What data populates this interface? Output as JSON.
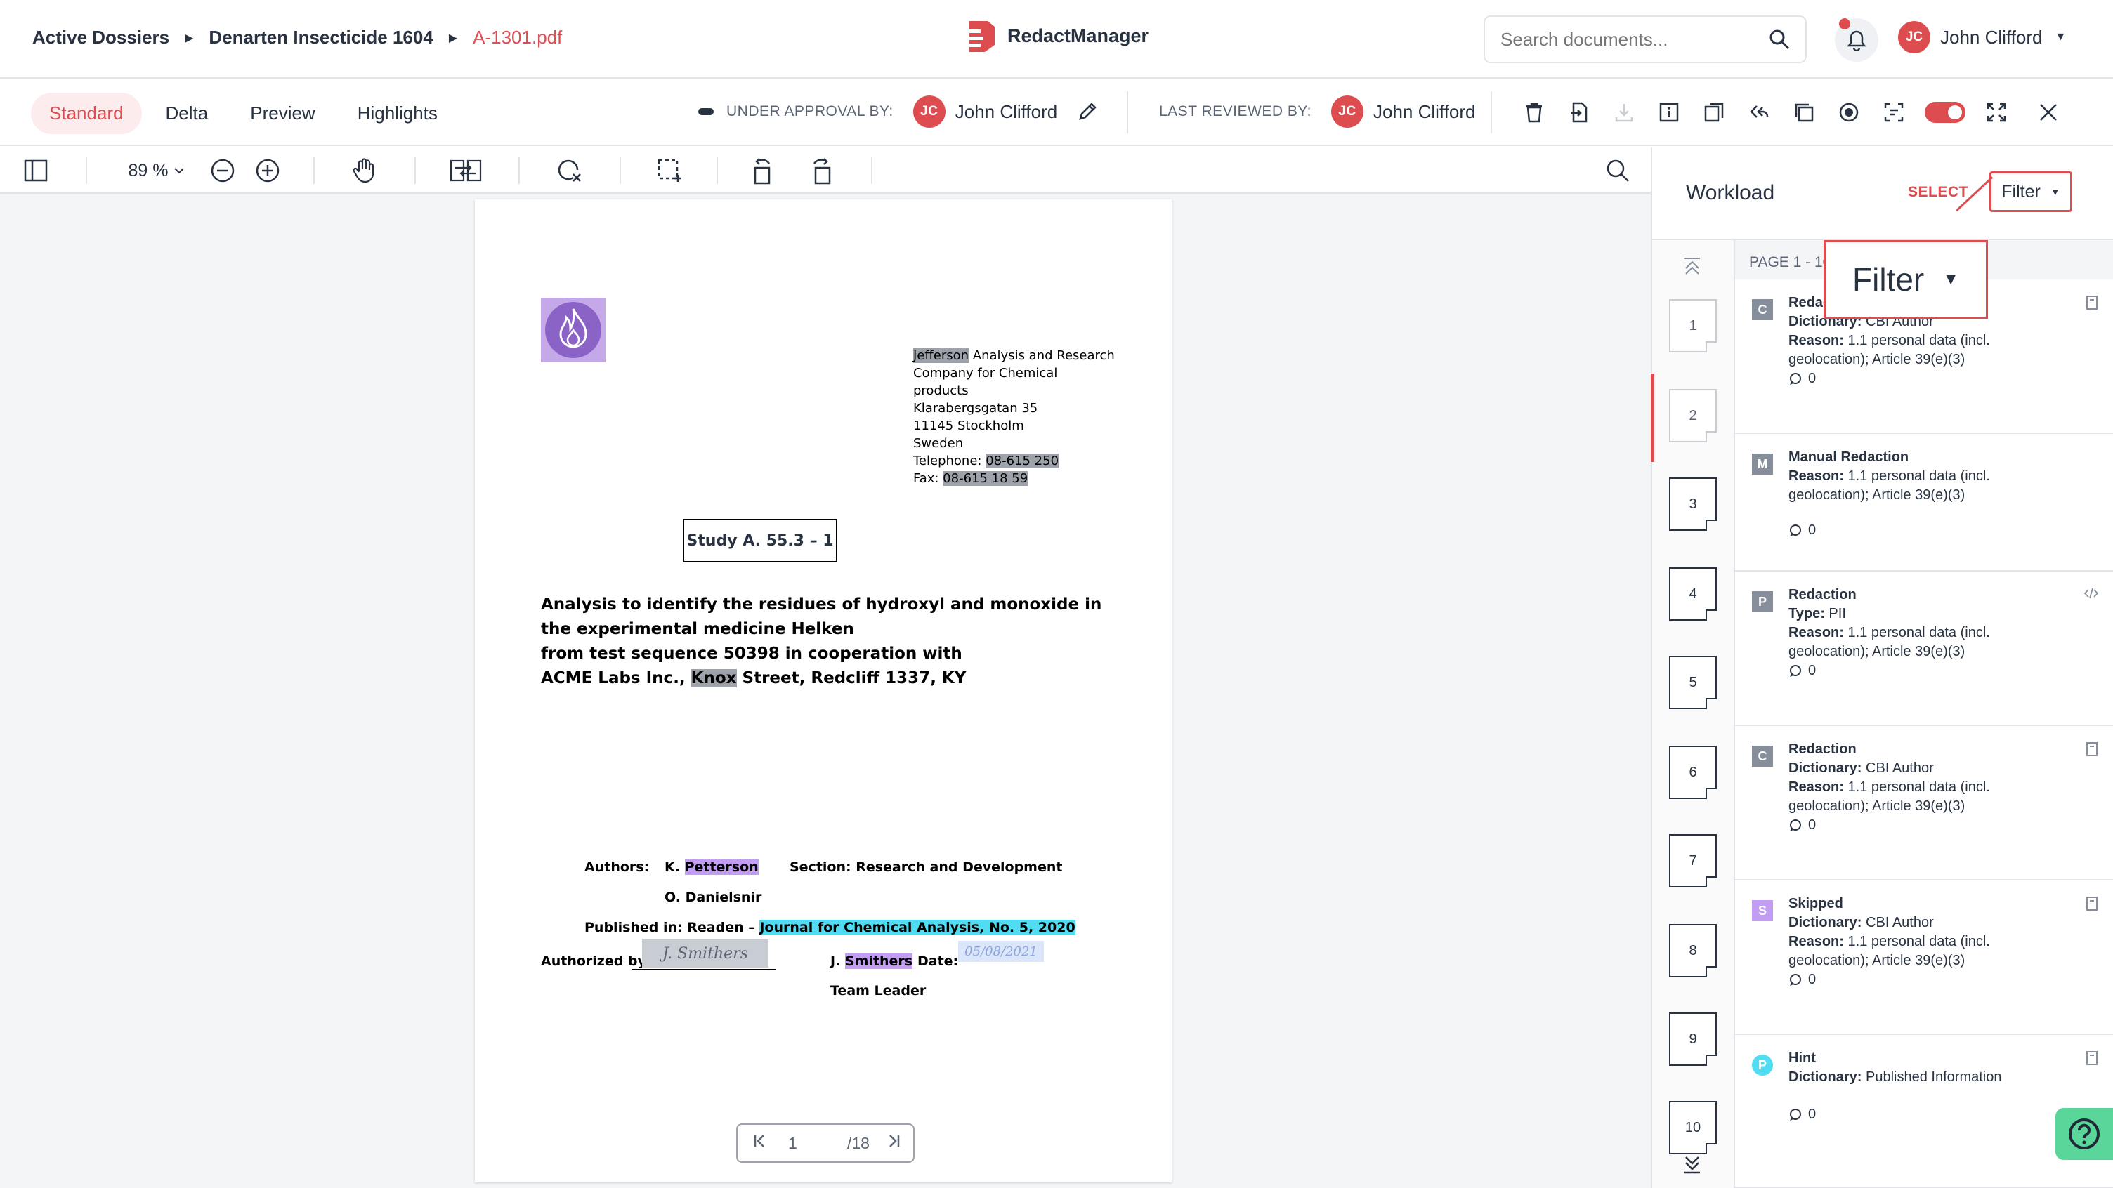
{
  "breadcrumb": {
    "items": [
      "Active Dossiers",
      "Denarten Insecticide 1604"
    ],
    "current": "A-1301.pdf"
  },
  "brand": {
    "name": "RedactManager"
  },
  "search": {
    "placeholder": "Search documents..."
  },
  "user": {
    "initials": "JC",
    "name": "John Clifford"
  },
  "tabs": [
    "Standard",
    "Delta",
    "Preview",
    "Highlights"
  ],
  "approval": {
    "label": "UNDER APPROVAL BY:",
    "initials": "JC",
    "name": "John Clifford"
  },
  "reviewed": {
    "label": "LAST REVIEWED BY:",
    "initials": "JC",
    "name": "John Clifford"
  },
  "viewer": {
    "zoom": "89 %"
  },
  "document": {
    "address": [
      "Jefferson",
      " Analysis and Research",
      "Company for Chemical",
      "products",
      "Klarabergsgatan 35",
      "11145 Stockholm",
      "Sweden",
      "Telephone: ",
      "08-615 250",
      "Fax: ",
      "08-615 18 59"
    ],
    "study": "Study A. 55.3 – 1",
    "analysis": [
      "Analysis to identify the residues of hydroxyl and monoxide in",
      "the experimental medicine Helken",
      "from test sequence 50398 in cooperation with",
      "ACME Labs Inc., ",
      "Knox",
      " Street, Redcliff 1337, KY"
    ],
    "authors_label": "Authors:",
    "author1_prefix": "K. ",
    "author1_name": "Petterson",
    "section": "Section: Research and Development",
    "author2": "O. Danielsnir",
    "published_label": "Published in: Readen – ",
    "published_journal": "Journal for Chemical Analysis, No. 5, 2020",
    "authorized_label": "Authorized by:",
    "signature": "J. Smithers",
    "signer_prefix": "J. ",
    "signer_name": "Smithers",
    "date_label": "Date:",
    "date_value": "05/08/2021",
    "team_leader": "Team Leader"
  },
  "pager": {
    "current": "1",
    "total": "/18"
  },
  "workload": {
    "title": "Workload",
    "select": "SELECT",
    "filter": "Filter",
    "page_range": "PAGE 1 - 10",
    "thumbnails": [
      "1",
      "2",
      "3",
      "4",
      "5",
      "6",
      "7",
      "8",
      "9",
      "10"
    ],
    "annotations": [
      {
        "badge": "C",
        "type": "Redaction",
        "line1_label": "Dictionary:",
        "line1_value": "CBI Author",
        "reason_label": "Reason:",
        "reason": "1.1 personal data (incl. geolocation); Article 39(e)(3)",
        "comments": "0"
      },
      {
        "badge": "M",
        "type": "Manual Redaction",
        "line1_label": "",
        "line1_value": "",
        "reason_label": "Reason:",
        "reason": "1.1 personal data (incl. geolocation); Article 39(e)(3)",
        "comments": "0"
      },
      {
        "badge": "P",
        "type": "Redaction",
        "line1_label": "Type:",
        "line1_value": "PII",
        "reason_label": "Reason:",
        "reason": "1.1 personal data (incl. geolocation); Article 39(e)(3)",
        "comments": "0"
      },
      {
        "badge": "C",
        "type": "Redaction",
        "line1_label": "Dictionary:",
        "line1_value": "CBI Author",
        "reason_label": "Reason:",
        "reason": "1.1 personal data (incl. geolocation); Article 39(e)(3)",
        "comments": "0"
      },
      {
        "badge": "S",
        "type": "Skipped",
        "line1_label": "Dictionary:",
        "line1_value": "CBI Author",
        "reason_label": "Reason:",
        "reason": "1.1 personal data (incl. geolocation); Article 39(e)(3)",
        "comments": "0"
      },
      {
        "badge": "P",
        "type": "Hint",
        "line1_label": "Dictionary:",
        "line1_value": "Published Information",
        "reason_label": "",
        "reason": "",
        "comments": "0"
      }
    ]
  },
  "colors": {
    "accent": "#dd4d50",
    "help": "#5ad69a"
  }
}
